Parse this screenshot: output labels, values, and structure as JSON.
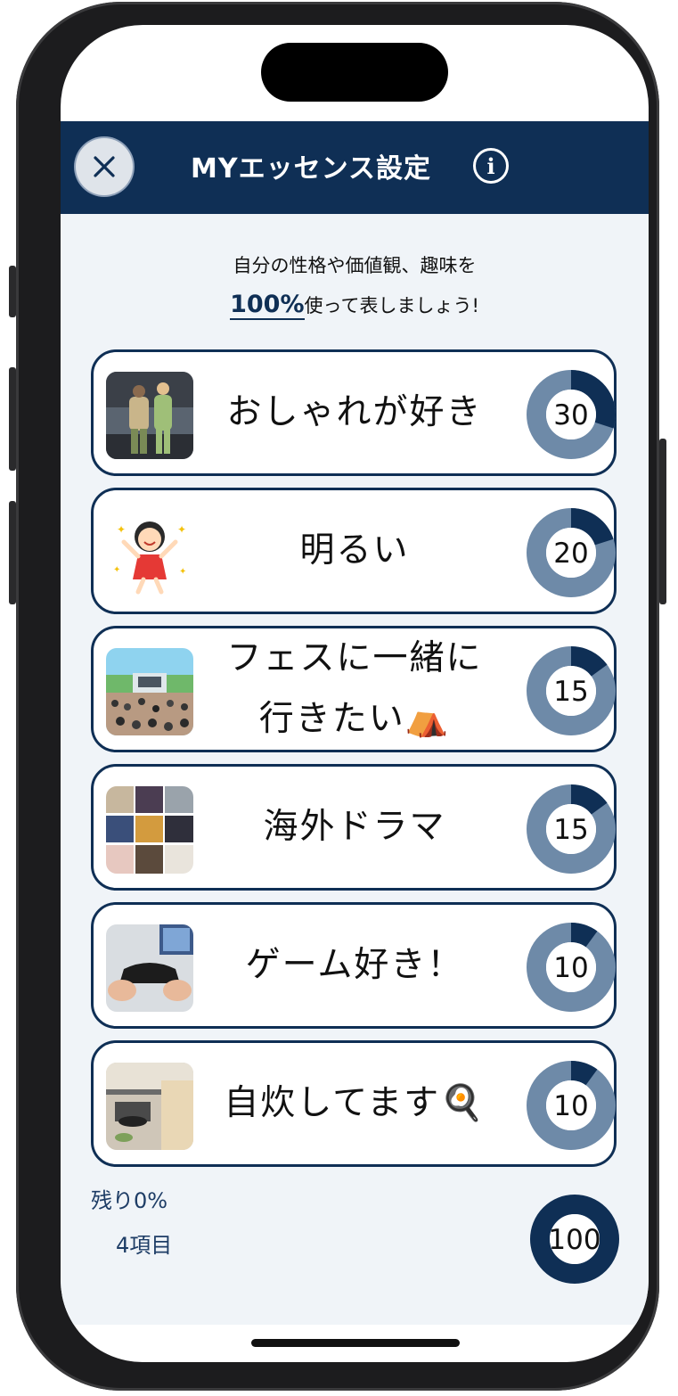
{
  "header": {
    "title": "MYエッセンス設定",
    "close_icon": "close-icon",
    "info_icon": "info-icon"
  },
  "intro": {
    "line1": "自分の性格や価値観、趣味を",
    "highlight": "100%",
    "line2_rest": "使って表しましょう!"
  },
  "items": [
    {
      "label": "おしゃれが好き",
      "label2": "",
      "value": 30,
      "thumb": "fashion-couple-photo"
    },
    {
      "label": "明るい",
      "label2": "",
      "value": 20,
      "thumb": "cheerful-girl-illustration"
    },
    {
      "label": "フェスに一緒に",
      "label2": "行きたい⛺",
      "value": 15,
      "thumb": "music-festival-photo"
    },
    {
      "label": "海外ドラマ",
      "label2": "",
      "value": 15,
      "thumb": "tv-drama-posters"
    },
    {
      "label": "ゲーム好き！",
      "label2": "",
      "value": 10,
      "thumb": "game-controller-photo"
    },
    {
      "label": "自炊してます🍳",
      "label2": "",
      "value": 10,
      "thumb": "cooking-photo"
    }
  ],
  "footer": {
    "remaining": "残り0%",
    "count": "4項目",
    "total": "100"
  },
  "colors": {
    "navy": "#0f2f55",
    "ring": "#6e8aa8",
    "background": "#f0f4f8"
  }
}
